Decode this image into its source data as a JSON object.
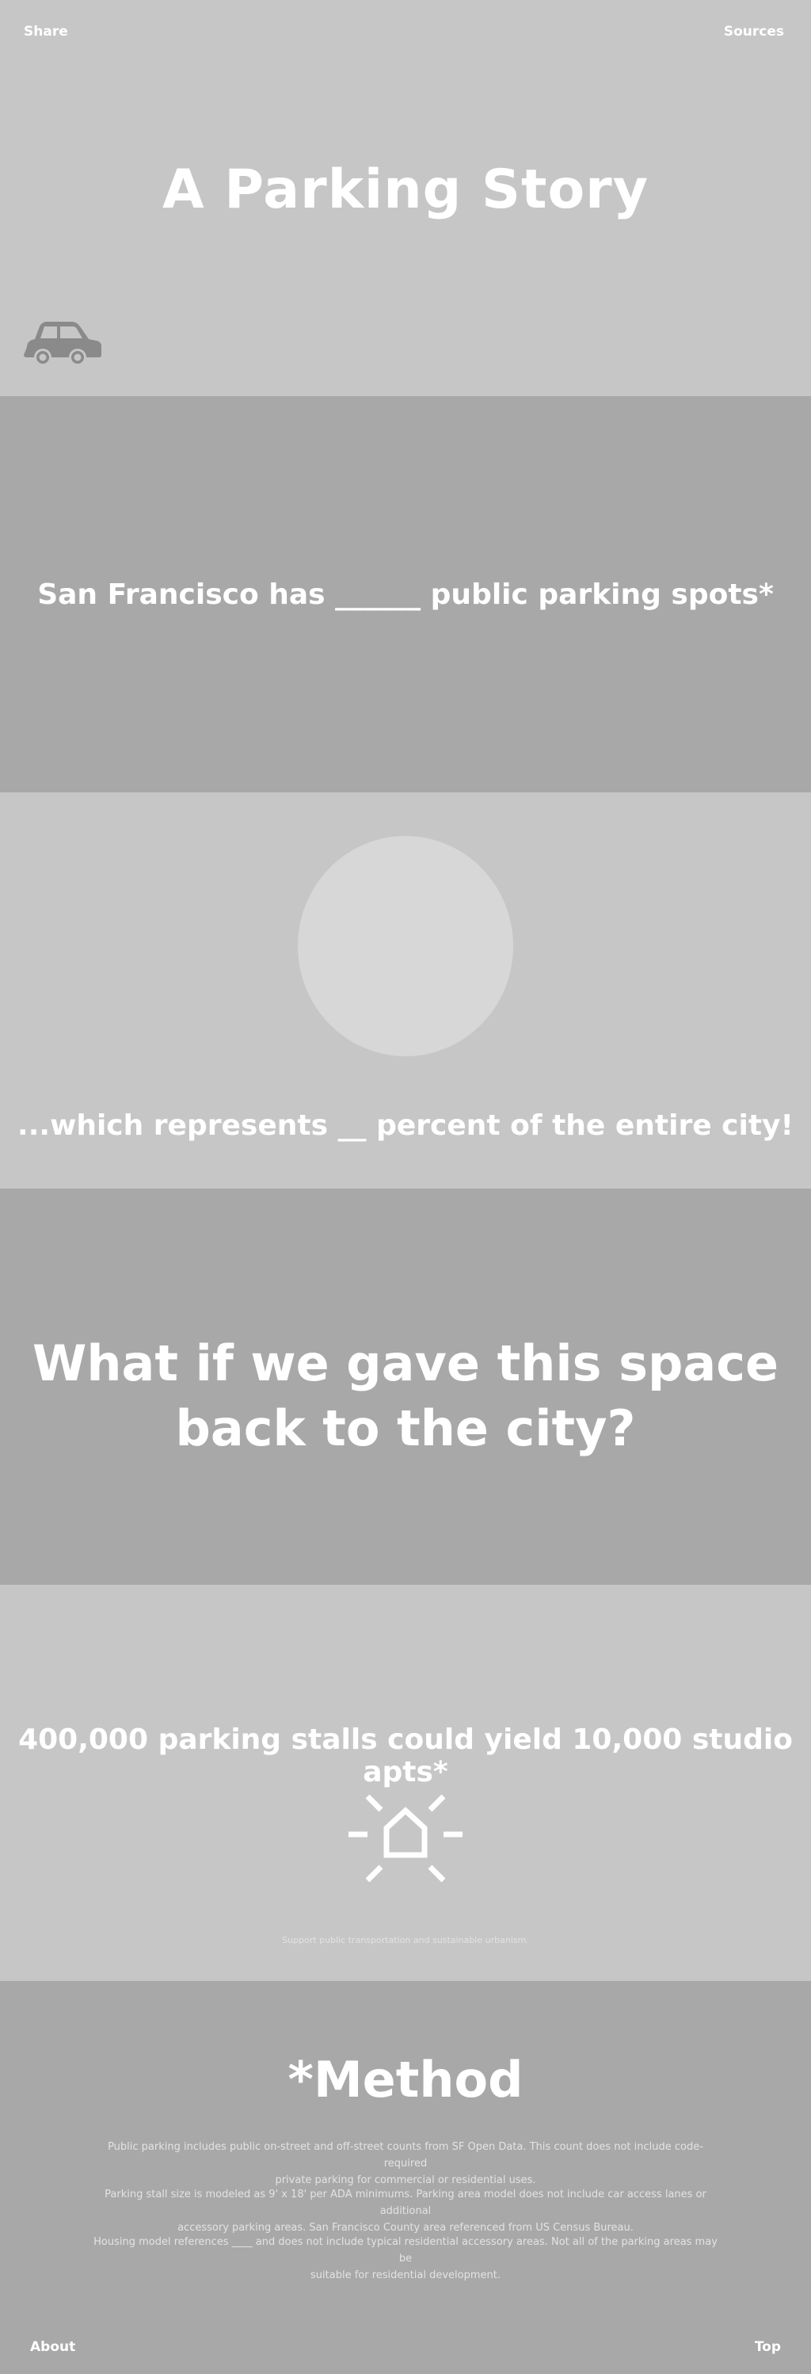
{
  "header": {
    "share_label": "Share",
    "sources_label": "Sources"
  },
  "hero": {
    "title": "A Parking Story",
    "icon": "car-icon"
  },
  "spots": {
    "headline": "San Francisco has ______ public parking spots*"
  },
  "percent": {
    "headline": "...which represents __ percent of the entire city!"
  },
  "question": {
    "line1": "What if we gave this space",
    "line2": "back to the city?"
  },
  "yield": {
    "headline": "400,000 parking stalls could yield 10,000 studio apts*",
    "icon": "house-icon",
    "caption": "Support public transportation and sustainable urbanism."
  },
  "method": {
    "title": "*Method",
    "p1_l1": "Public parking includes public on-street and off-street counts from SF Open Data. This count does not include code-required",
    "p1_l2": "private parking for commercial or residential uses.",
    "p2_l1": "Parking stall size is modeled as  9' x 18' per ADA minimums. Parking area model does not include car access lanes or additional",
    "p2_l2": "accessory parking areas. San Francisco County area referenced from US Census Bureau.",
    "p3_l1": "Housing model references ____ and does not include typical residential accessory areas.  Not all of the parking areas may be",
    "p3_l2": "suitable for residential development."
  },
  "footer": {
    "about_label": "About",
    "top_label": "Top"
  },
  "colors": {
    "light_bg": "#c6c6c6",
    "dark_bg": "#a8a8a8",
    "icon_gray": "#8a8a8a",
    "circle": "#d7d7d7",
    "text": "#ffffff"
  }
}
